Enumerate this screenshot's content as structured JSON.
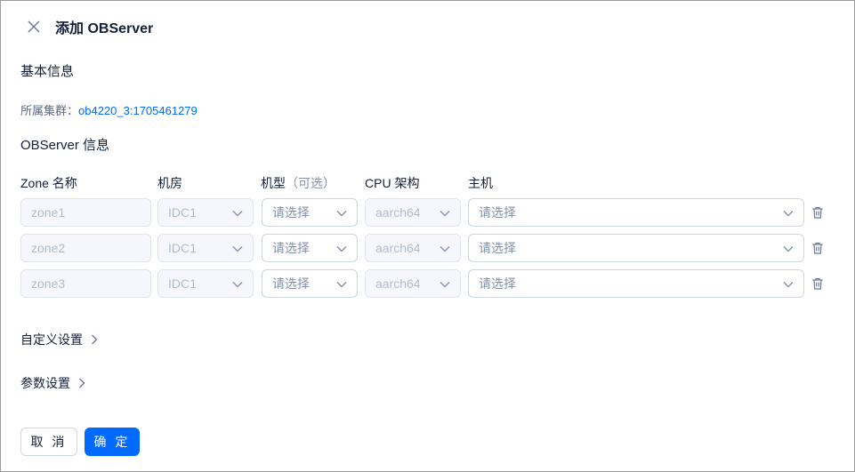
{
  "header": {
    "title": "添加 OBServer",
    "close_icon": "close-icon"
  },
  "basic": {
    "section_title": "基本信息",
    "cluster_label": "所属集群：",
    "cluster_value": "ob4220_3:1705461279"
  },
  "observer": {
    "section_title": "OBServer 信息",
    "columns": {
      "zone": "Zone 名称",
      "idc": "机房",
      "model": "机型",
      "model_optional": "（可选）",
      "arch": "CPU 架构",
      "host": "主机"
    },
    "rows": [
      {
        "zone": "zone1",
        "idc": "IDC1",
        "model_placeholder": "请选择",
        "arch": "aarch64",
        "host_placeholder": "请选择"
      },
      {
        "zone": "zone2",
        "idc": "IDC1",
        "model_placeholder": "请选择",
        "arch": "aarch64",
        "host_placeholder": "请选择"
      },
      {
        "zone": "zone3",
        "idc": "IDC1",
        "model_placeholder": "请选择",
        "arch": "aarch64",
        "host_placeholder": "请选择"
      }
    ]
  },
  "custom_settings": {
    "label": "自定义设置"
  },
  "param_settings": {
    "label": "参数设置"
  },
  "footer": {
    "cancel_label": "取 消",
    "ok_label": "确 定"
  },
  "colors": {
    "primary": "#006aff",
    "text": "#132039",
    "muted": "#8592ad",
    "border": "#cdd5e4"
  }
}
